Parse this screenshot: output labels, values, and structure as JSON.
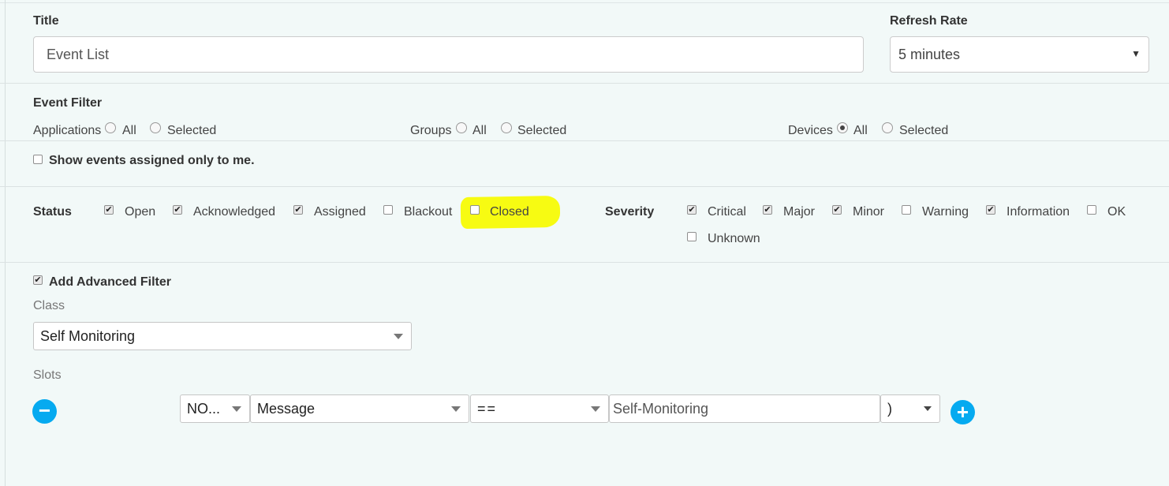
{
  "title_section": {
    "title_label": "Title",
    "title_value": "Event List",
    "refresh_label": "Refresh Rate",
    "refresh_value": "5 minutes"
  },
  "event_filter": {
    "heading": "Event Filter",
    "applications": {
      "label": "Applications",
      "all": "All",
      "selected": "Selected",
      "value": "none"
    },
    "groups": {
      "label": "Groups",
      "all": "All",
      "selected": "Selected",
      "value": "none"
    },
    "devices": {
      "label": "Devices",
      "all": "All",
      "selected": "Selected",
      "value": "All"
    }
  },
  "assigned_only": {
    "label": "Show events assigned only to me.",
    "checked": false
  },
  "status": {
    "label": "Status",
    "items": [
      {
        "label": "Open",
        "checked": true
      },
      {
        "label": "Acknowledged",
        "checked": true
      },
      {
        "label": "Assigned",
        "checked": true
      },
      {
        "label": "Blackout",
        "checked": false
      },
      {
        "label": "Closed",
        "checked": false,
        "highlight_color": "#f7fb12"
      }
    ]
  },
  "severity": {
    "label": "Severity",
    "items": [
      {
        "label": "Critical",
        "checked": true
      },
      {
        "label": "Major",
        "checked": true
      },
      {
        "label": "Minor",
        "checked": true
      },
      {
        "label": "Warning",
        "checked": false
      },
      {
        "label": "Information",
        "checked": true
      },
      {
        "label": "OK",
        "checked": false
      },
      {
        "label": "Unknown",
        "checked": false
      }
    ]
  },
  "advanced": {
    "label": "Add Advanced Filter",
    "checked": true,
    "class_label": "Class",
    "class_value": "Self Monitoring",
    "slots_label": "Slots",
    "slot_row": {
      "operator": "NO...",
      "field": "Message",
      "comparison": "==",
      "value": "Self-Monitoring",
      "paren": ")"
    },
    "remove_symbol": "−",
    "add_symbol": "+"
  },
  "colors": {
    "accent": "#06aaf0",
    "background": "#f2f9f8"
  },
  "icons": {
    "checkmark": "✔",
    "dropdown": "chevron-down-icon"
  }
}
